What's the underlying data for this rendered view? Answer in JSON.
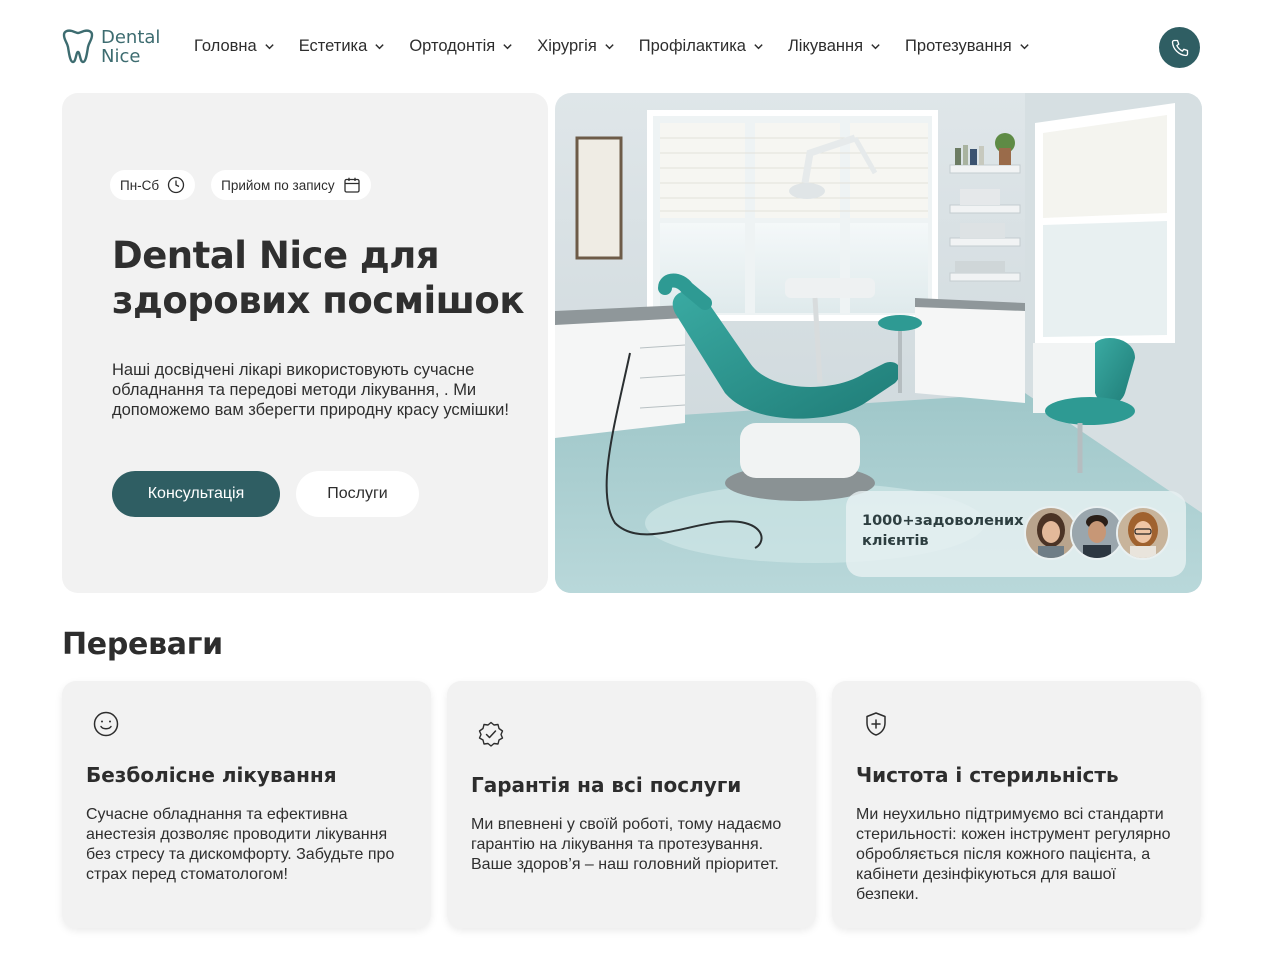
{
  "logo": {
    "line1": "Dental",
    "line2": "Nice",
    "icon": "tooth-icon"
  },
  "nav": {
    "items": [
      {
        "label": "Головна"
      },
      {
        "label": "Естетика"
      },
      {
        "label": "Ортодонтія"
      },
      {
        "label": "Хірургія"
      },
      {
        "label": "Профілактика"
      },
      {
        "label": "Лікування"
      },
      {
        "label": "Протезування"
      }
    ],
    "phone_icon": "phone-icon"
  },
  "hero": {
    "tag_schedule": "Пн-Сб",
    "tag_appointment": "Прийом по запису",
    "title": "Dental Nice для здорових посмішок",
    "description": "Наші досвідчені лікарі використовують сучасне обладнання та передові методи лікування, . Ми допоможемо вам зберегти природну красу усмішки!",
    "btn_consult": "Консультація",
    "btn_services": "Послуги",
    "clients_text": "1000+задоволених клієнтів"
  },
  "advantages": {
    "title": "Переваги",
    "cards": [
      {
        "icon": "smile-icon",
        "title": "Безболісне лікування",
        "text": "Сучасне обладнання та ефективна анестезія дозволяє проводити лікування без стресу та дискомфорту. Забудьте про страх перед стоматологом!"
      },
      {
        "icon": "badge-check-icon",
        "title": "Гарантія на всі послуги",
        "text": "Ми впевнені у своїй роботі, тому надаємо гарантію на лікування та протезування. Ваше здоров’я – наш головний пріоритет."
      },
      {
        "icon": "shield-plus-icon",
        "title": "Чистота і стерильність",
        "text": "Ми неухильно підтримуємо всі стандарти стерильності: кожен інструмент регулярно обробляється після кожного пацієнта, а кабінети дезінфікуються для вашої безпеки."
      }
    ]
  },
  "colors": {
    "accent": "#2f5e63",
    "card_bg": "#f2f2f2",
    "chair_teal": "#2e9a93"
  }
}
